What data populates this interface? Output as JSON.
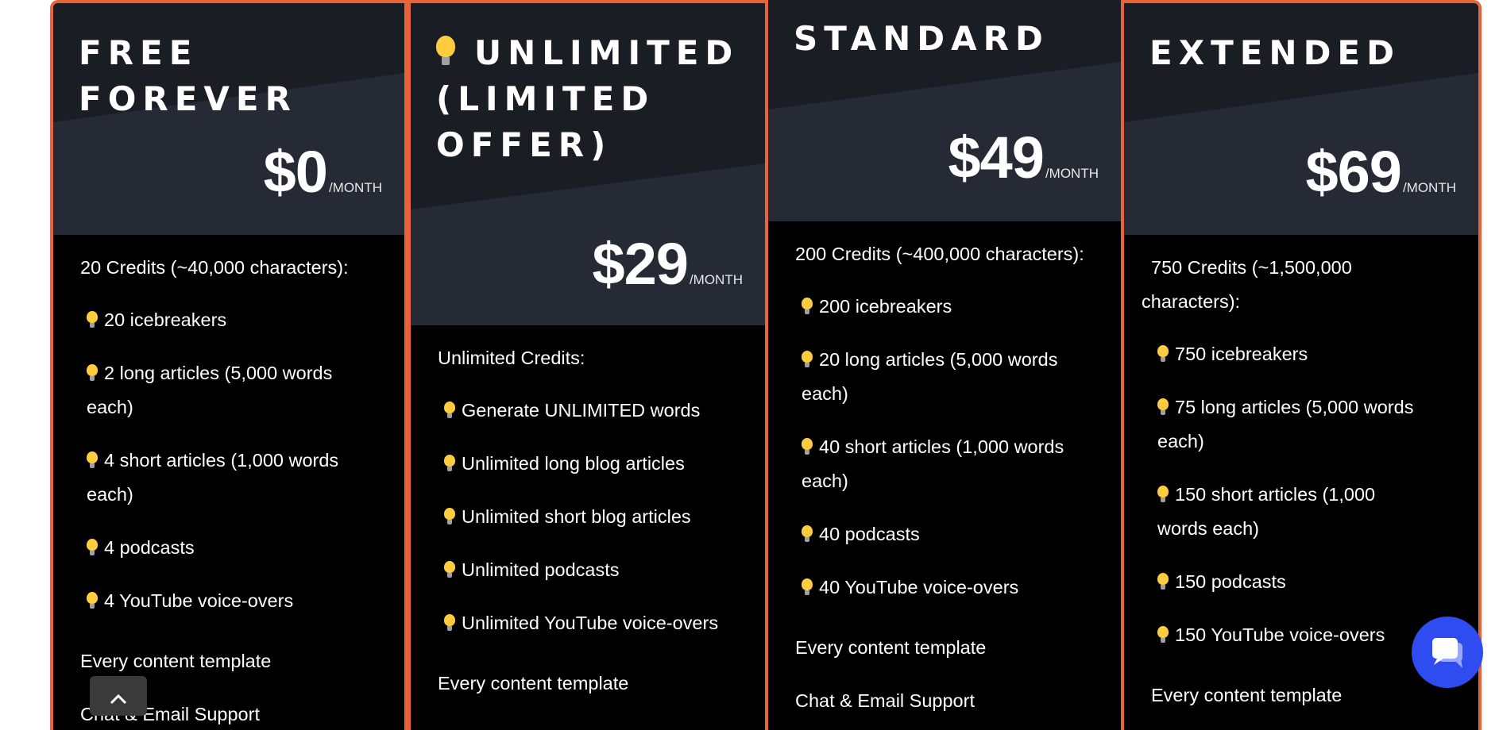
{
  "accent_color": "#e8633a",
  "plans": [
    {
      "title": "FREE FOREVER",
      "price": "$0",
      "period": "/MONTH",
      "intro": "20 Credits (~40,000 characters):",
      "features": [
        "20 icebreakers",
        "2 long articles (5,000 words each)",
        "4 short articles (1,000 words each)",
        "4 podcasts",
        "4 YouTube voice-overs"
      ],
      "extras": [
        "Every content template",
        "Chat & Email Support"
      ]
    },
    {
      "title": "UNLIMITED (LIMITED OFFER)",
      "title_icon": "lightbulb-icon",
      "price": "$29",
      "period": "/MONTH",
      "intro": "Unlimited Credits:",
      "features": [
        "Generate UNLIMITED words",
        "Unlimited long blog articles",
        "Unlimited short blog articles",
        "Unlimited podcasts",
        "Unlimited YouTube voice-overs"
      ],
      "extras": [
        "Every content template"
      ]
    },
    {
      "title": "STANDARD",
      "price": "$49",
      "period": "/MONTH",
      "intro": "200 Credits (~400,000 characters):",
      "features": [
        "200 icebreakers",
        "20 long articles (5,000 words each)",
        "40 short articles (1,000 words each)",
        "40 podcasts",
        "40 YouTube voice-overs"
      ],
      "extras": [
        "Every content template",
        "Chat & Email Support"
      ]
    },
    {
      "title": "EXTENDED",
      "price": "$69",
      "period": "/MONTH",
      "intro": "750 Credits (~1,500,000 characters):",
      "features": [
        "750 icebreakers",
        "75 long articles (5,000 words each)",
        "150 short articles (1,000 words each)",
        "150 podcasts",
        "150 YouTube voice-overs"
      ],
      "extras": [
        "Every content template"
      ]
    }
  ],
  "feature_icon": "lightbulb-icon",
  "scroll_top_icon": "chevron-up-icon",
  "chat_icon": "chat-bubble-icon"
}
